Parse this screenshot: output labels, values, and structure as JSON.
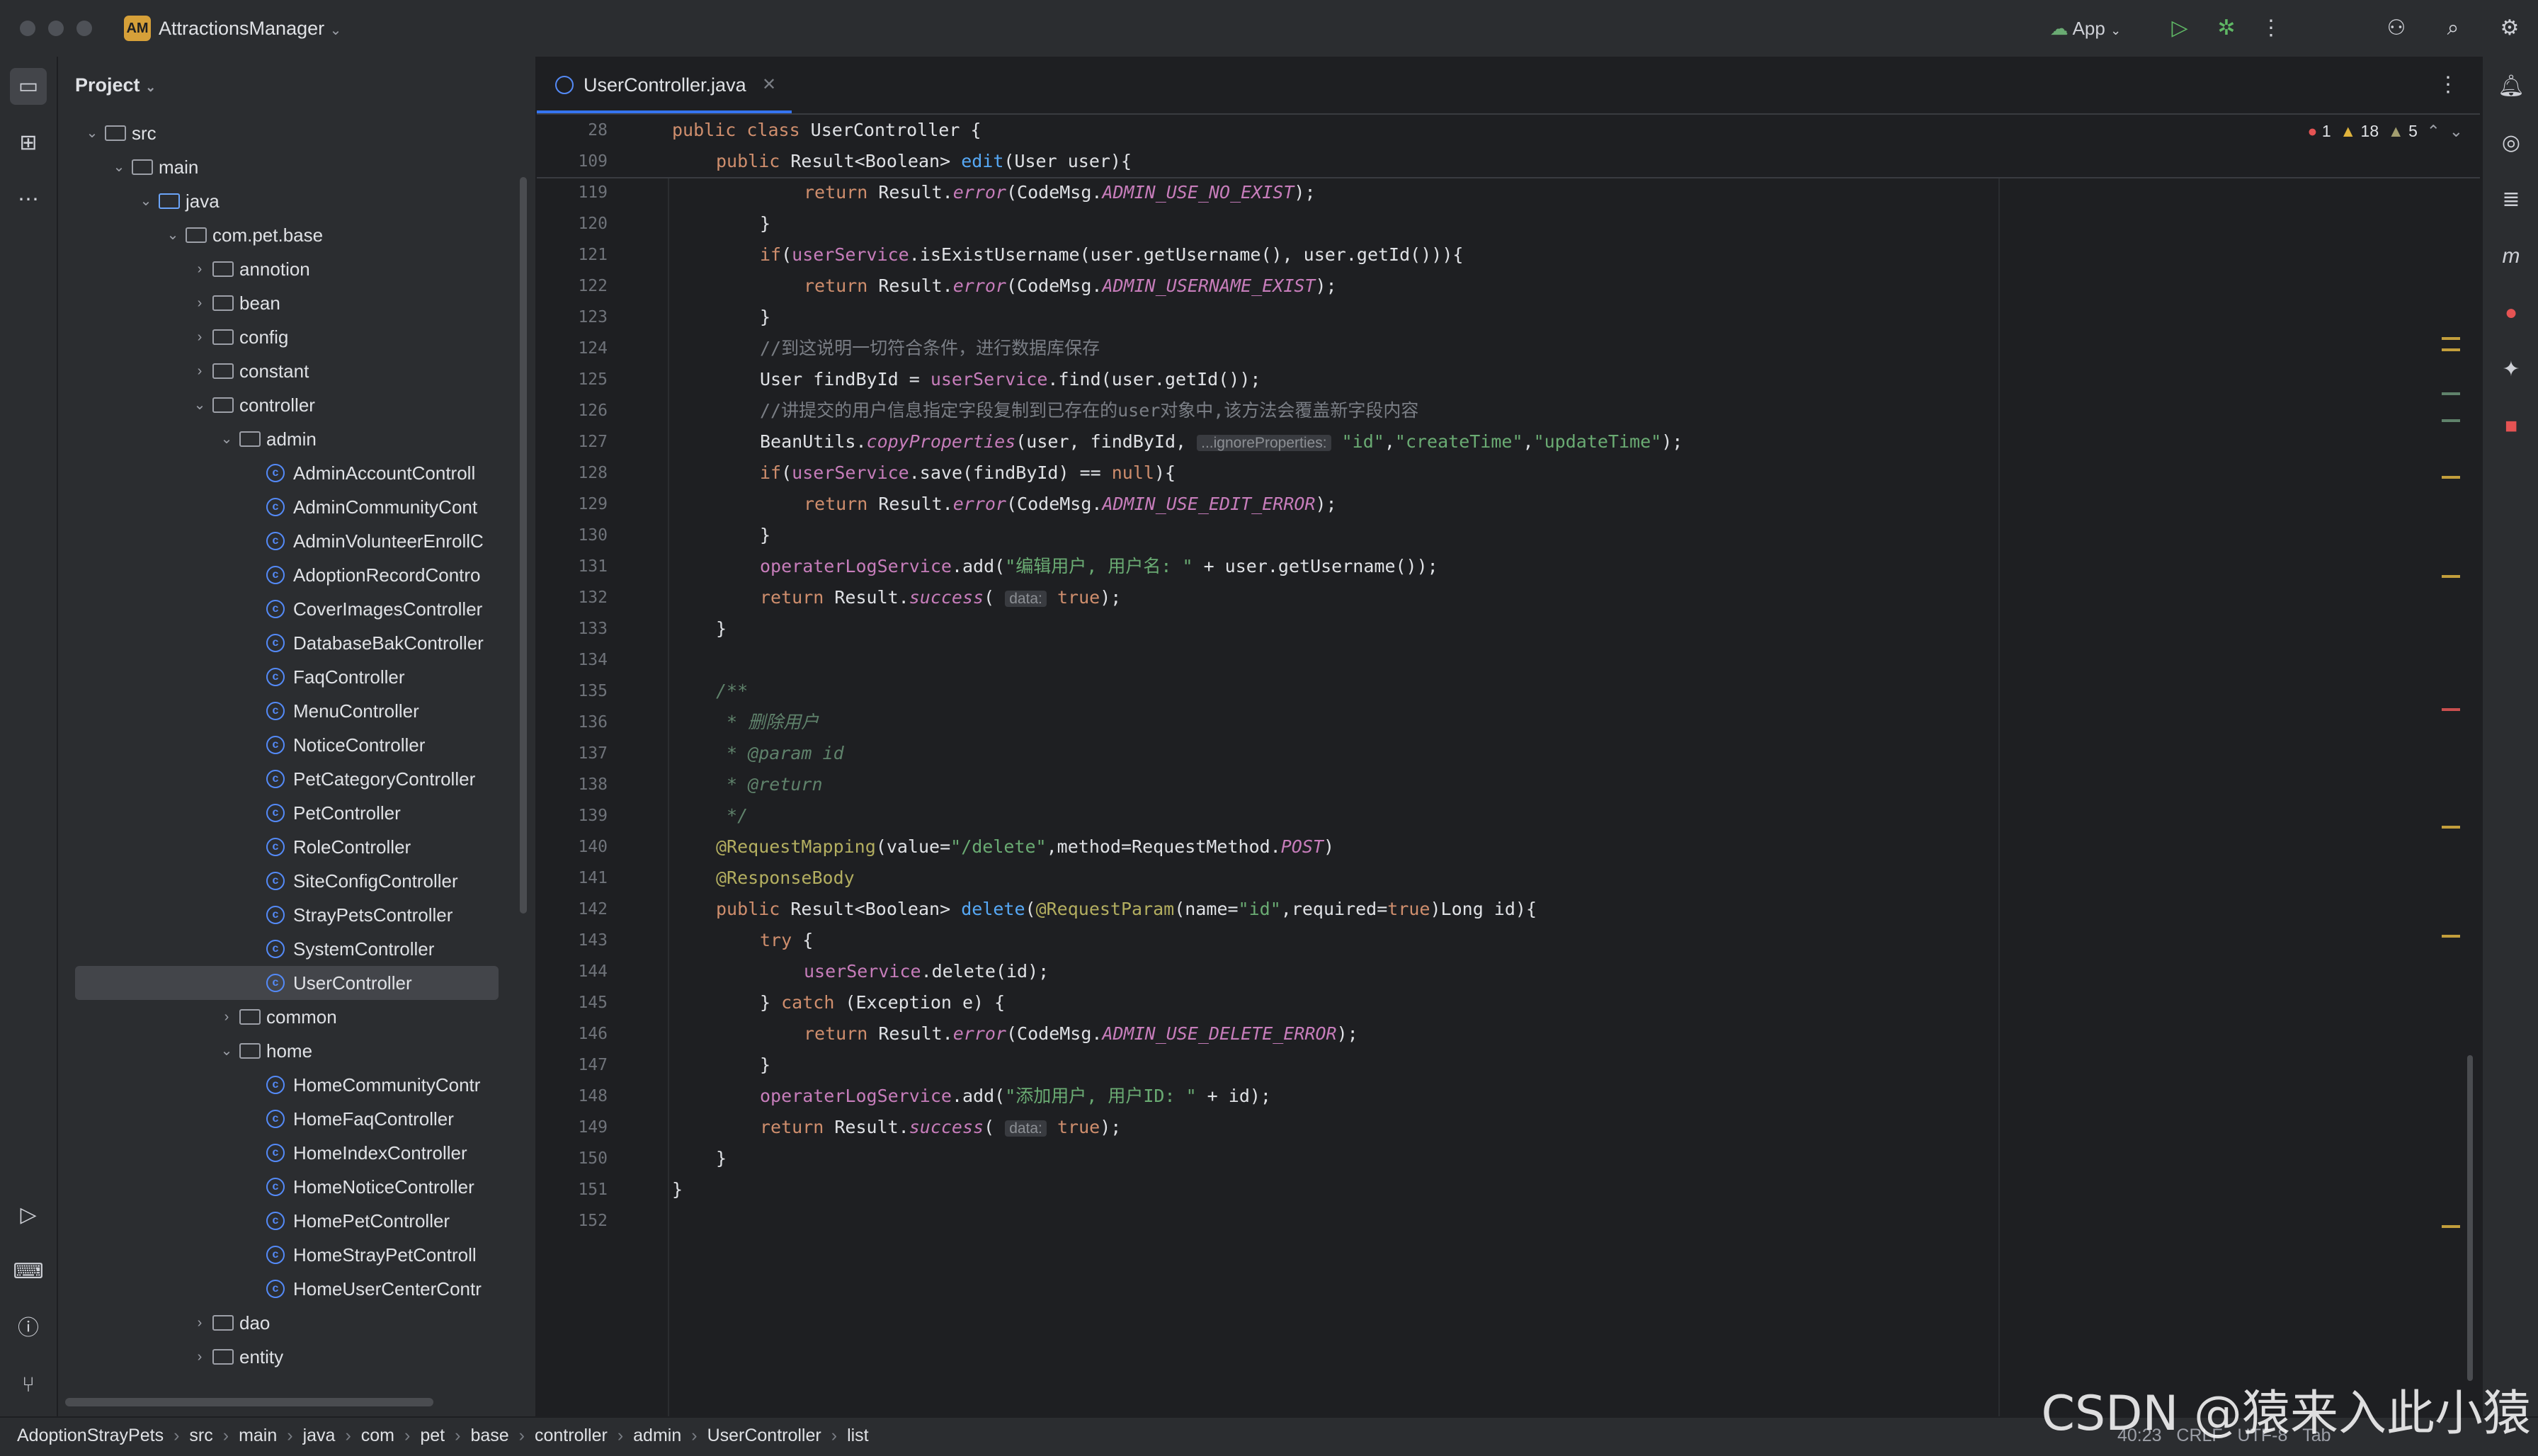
{
  "window": {
    "project_name": "AttractionsManager",
    "project_badge": "AM",
    "run_config": "App"
  },
  "sidebar": {
    "header": "Project",
    "tree": [
      {
        "depth": 1,
        "type": "folder",
        "label": "src",
        "expanded": true
      },
      {
        "depth": 2,
        "type": "folder",
        "label": "main",
        "expanded": true
      },
      {
        "depth": 3,
        "type": "folder-blue",
        "label": "java",
        "expanded": true
      },
      {
        "depth": 4,
        "type": "package",
        "label": "com.pet.base",
        "expanded": true
      },
      {
        "depth": 5,
        "type": "package",
        "label": "annotion",
        "expanded": false
      },
      {
        "depth": 5,
        "type": "package",
        "label": "bean",
        "expanded": false
      },
      {
        "depth": 5,
        "type": "package",
        "label": "config",
        "expanded": false
      },
      {
        "depth": 5,
        "type": "package",
        "label": "constant",
        "expanded": false
      },
      {
        "depth": 5,
        "type": "package",
        "label": "controller",
        "expanded": true
      },
      {
        "depth": 6,
        "type": "package",
        "label": "admin",
        "expanded": true
      },
      {
        "depth": 7,
        "type": "class",
        "label": "AdminAccountControll"
      },
      {
        "depth": 7,
        "type": "class",
        "label": "AdminCommunityCont"
      },
      {
        "depth": 7,
        "type": "class",
        "label": "AdminVolunteerEnrollC"
      },
      {
        "depth": 7,
        "type": "class",
        "label": "AdoptionRecordContro"
      },
      {
        "depth": 7,
        "type": "class",
        "label": "CoverImagesController"
      },
      {
        "depth": 7,
        "type": "class",
        "label": "DatabaseBakController"
      },
      {
        "depth": 7,
        "type": "class",
        "label": "FaqController"
      },
      {
        "depth": 7,
        "type": "class",
        "label": "MenuController"
      },
      {
        "depth": 7,
        "type": "class",
        "label": "NoticeController"
      },
      {
        "depth": 7,
        "type": "class",
        "label": "PetCategoryController"
      },
      {
        "depth": 7,
        "type": "class",
        "label": "PetController"
      },
      {
        "depth": 7,
        "type": "class",
        "label": "RoleController"
      },
      {
        "depth": 7,
        "type": "class",
        "label": "SiteConfigController"
      },
      {
        "depth": 7,
        "type": "class",
        "label": "StrayPetsController"
      },
      {
        "depth": 7,
        "type": "class",
        "label": "SystemController"
      },
      {
        "depth": 7,
        "type": "class",
        "label": "UserController",
        "selected": true
      },
      {
        "depth": 6,
        "type": "package",
        "label": "common",
        "expanded": false
      },
      {
        "depth": 6,
        "type": "package",
        "label": "home",
        "expanded": true
      },
      {
        "depth": 7,
        "type": "class",
        "label": "HomeCommunityContr"
      },
      {
        "depth": 7,
        "type": "class",
        "label": "HomeFaqController"
      },
      {
        "depth": 7,
        "type": "class",
        "label": "HomeIndexController"
      },
      {
        "depth": 7,
        "type": "class",
        "label": "HomeNoticeController"
      },
      {
        "depth": 7,
        "type": "class",
        "label": "HomePetController"
      },
      {
        "depth": 7,
        "type": "class",
        "label": "HomeStrayPetControll"
      },
      {
        "depth": 7,
        "type": "class",
        "label": "HomeUserCenterContr"
      },
      {
        "depth": 5,
        "type": "package",
        "label": "dao",
        "expanded": false
      },
      {
        "depth": 5,
        "type": "package",
        "label": "entity",
        "expanded": false
      }
    ]
  },
  "editor": {
    "tab_label": "UserController.java",
    "inspections": {
      "errors": "1",
      "warnings": "18",
      "weak_warnings": "5"
    },
    "sticky_lines": [
      {
        "num": "28",
        "indent": 0,
        "tokens": [
          {
            "t": "public class ",
            "c": "kw"
          },
          {
            "t": "UserController {",
            "c": ""
          }
        ]
      },
      {
        "num": "109",
        "indent": 1,
        "tokens": [
          {
            "t": "public ",
            "c": "kw"
          },
          {
            "t": "Result<Boolean> ",
            "c": ""
          },
          {
            "t": "edit",
            "c": "fn"
          },
          {
            "t": "(User user){",
            "c": ""
          }
        ]
      }
    ],
    "lines": [
      {
        "num": "119",
        "indent": 3,
        "tokens": [
          {
            "t": "return ",
            "c": "kw"
          },
          {
            "t": "Result.",
            "c": ""
          },
          {
            "t": "error",
            "c": "it"
          },
          {
            "t": "(CodeMsg.",
            "c": ""
          },
          {
            "t": "ADMIN_USE_NO_EXIST",
            "c": "it"
          },
          {
            "t": ");",
            "c": ""
          }
        ]
      },
      {
        "num": "120",
        "indent": 2,
        "tokens": [
          {
            "t": "}",
            "c": ""
          }
        ]
      },
      {
        "num": "121",
        "indent": 2,
        "tokens": [
          {
            "t": "if",
            "c": "kw"
          },
          {
            "t": "(",
            "c": ""
          },
          {
            "t": "userService",
            "c": "fld"
          },
          {
            "t": ".isExistUsername(user.getUsername(), user.getId())){",
            "c": ""
          }
        ]
      },
      {
        "num": "122",
        "indent": 3,
        "tokens": [
          {
            "t": "return ",
            "c": "kw"
          },
          {
            "t": "Result.",
            "c": ""
          },
          {
            "t": "error",
            "c": "it"
          },
          {
            "t": "(CodeMsg.",
            "c": ""
          },
          {
            "t": "ADMIN_USERNAME_EXIST",
            "c": "it"
          },
          {
            "t": ");",
            "c": ""
          }
        ]
      },
      {
        "num": "123",
        "indent": 2,
        "tokens": [
          {
            "t": "}",
            "c": ""
          }
        ]
      },
      {
        "num": "124",
        "indent": 2,
        "tokens": [
          {
            "t": "//到这说明一切符合条件，进行数据库保存",
            "c": "cm"
          }
        ]
      },
      {
        "num": "125",
        "indent": 2,
        "tokens": [
          {
            "t": "User findById = ",
            "c": ""
          },
          {
            "t": "userService",
            "c": "fld"
          },
          {
            "t": ".find(user.getId());",
            "c": ""
          }
        ]
      },
      {
        "num": "126",
        "indent": 2,
        "tokens": [
          {
            "t": "//讲提交的用户信息指定字段复制到已存在的user对象中,该方法会覆盖新字段内容",
            "c": "cm"
          }
        ]
      },
      {
        "num": "127",
        "indent": 2,
        "tokens": [
          {
            "t": "BeanUtils.",
            "c": ""
          },
          {
            "t": "copyProperties",
            "c": "it"
          },
          {
            "t": "(user, findById, ",
            "c": ""
          },
          {
            "t": "...ignoreProperties:",
            "c": "hint"
          },
          {
            "t": " ",
            "c": ""
          },
          {
            "t": "\"id\"",
            "c": "str"
          },
          {
            "t": ",",
            "c": ""
          },
          {
            "t": "\"createTime\"",
            "c": "str"
          },
          {
            "t": ",",
            "c": ""
          },
          {
            "t": "\"updateTime\"",
            "c": "str"
          },
          {
            "t": ");",
            "c": ""
          }
        ]
      },
      {
        "num": "128",
        "indent": 2,
        "tokens": [
          {
            "t": "if",
            "c": "kw"
          },
          {
            "t": "(",
            "c": ""
          },
          {
            "t": "userService",
            "c": "fld"
          },
          {
            "t": ".save(findById) == ",
            "c": ""
          },
          {
            "t": "null",
            "c": "kw"
          },
          {
            "t": "){",
            "c": ""
          }
        ]
      },
      {
        "num": "129",
        "indent": 3,
        "tokens": [
          {
            "t": "return ",
            "c": "kw"
          },
          {
            "t": "Result.",
            "c": ""
          },
          {
            "t": "error",
            "c": "it"
          },
          {
            "t": "(CodeMsg.",
            "c": ""
          },
          {
            "t": "ADMIN_USE_EDIT_ERROR",
            "c": "it"
          },
          {
            "t": ");",
            "c": ""
          }
        ]
      },
      {
        "num": "130",
        "indent": 2,
        "tokens": [
          {
            "t": "}",
            "c": ""
          }
        ]
      },
      {
        "num": "131",
        "indent": 2,
        "tokens": [
          {
            "t": "operaterLogService",
            "c": "fld"
          },
          {
            "t": ".add(",
            "c": ""
          },
          {
            "t": "\"编辑用户, 用户名: \"",
            "c": "str"
          },
          {
            "t": " + user.getUsername());",
            "c": ""
          }
        ]
      },
      {
        "num": "132",
        "indent": 2,
        "tokens": [
          {
            "t": "return ",
            "c": "kw"
          },
          {
            "t": "Result.",
            "c": ""
          },
          {
            "t": "success",
            "c": "it"
          },
          {
            "t": "( ",
            "c": ""
          },
          {
            "t": "data:",
            "c": "hint"
          },
          {
            "t": " ",
            "c": ""
          },
          {
            "t": "true",
            "c": "kw"
          },
          {
            "t": ");",
            "c": ""
          }
        ]
      },
      {
        "num": "133",
        "indent": 1,
        "tokens": [
          {
            "t": "}",
            "c": ""
          }
        ]
      },
      {
        "num": "134",
        "indent": 0,
        "tokens": []
      },
      {
        "num": "135",
        "indent": 1,
        "tokens": [
          {
            "t": "/**",
            "c": "cmi"
          }
        ]
      },
      {
        "num": "136",
        "indent": 1,
        "tokens": [
          {
            "t": " * 删除用户",
            "c": "cmi"
          }
        ]
      },
      {
        "num": "137",
        "indent": 1,
        "tokens": [
          {
            "t": " * ",
            "c": "cmi"
          },
          {
            "t": "@param",
            "c": "cmi"
          },
          {
            "t": " id",
            "c": "cmi"
          }
        ]
      },
      {
        "num": "138",
        "indent": 1,
        "tokens": [
          {
            "t": " * ",
            "c": "cmi"
          },
          {
            "t": "@return",
            "c": "cmi"
          }
        ]
      },
      {
        "num": "139",
        "indent": 1,
        "tokens": [
          {
            "t": " */",
            "c": "cmi"
          }
        ]
      },
      {
        "num": "140",
        "indent": 1,
        "tokens": [
          {
            "t": "@RequestMapping",
            "c": "ann"
          },
          {
            "t": "(value=",
            "c": ""
          },
          {
            "t": "\"/delete\"",
            "c": "str"
          },
          {
            "t": ",method=RequestMethod.",
            "c": ""
          },
          {
            "t": "POST",
            "c": "it"
          },
          {
            "t": ")",
            "c": ""
          }
        ]
      },
      {
        "num": "141",
        "indent": 1,
        "tokens": [
          {
            "t": "@ResponseBody",
            "c": "ann"
          }
        ]
      },
      {
        "num": "142",
        "indent": 1,
        "tokens": [
          {
            "t": "public ",
            "c": "kw"
          },
          {
            "t": "Result<Boolean> ",
            "c": ""
          },
          {
            "t": "delete",
            "c": "fn"
          },
          {
            "t": "(",
            "c": ""
          },
          {
            "t": "@RequestParam",
            "c": "ann"
          },
          {
            "t": "(name=",
            "c": ""
          },
          {
            "t": "\"id\"",
            "c": "str"
          },
          {
            "t": ",required=",
            "c": ""
          },
          {
            "t": "true",
            "c": "kw"
          },
          {
            "t": ")Long id){",
            "c": ""
          }
        ]
      },
      {
        "num": "143",
        "indent": 2,
        "tokens": [
          {
            "t": "try ",
            "c": "kw"
          },
          {
            "t": "{",
            "c": ""
          }
        ]
      },
      {
        "num": "144",
        "indent": 3,
        "tokens": [
          {
            "t": "userService",
            "c": "fld"
          },
          {
            "t": ".delete(id);",
            "c": ""
          }
        ]
      },
      {
        "num": "145",
        "indent": 2,
        "tokens": [
          {
            "t": "} ",
            "c": ""
          },
          {
            "t": "catch ",
            "c": "kw"
          },
          {
            "t": "(Exception e) {",
            "c": ""
          }
        ]
      },
      {
        "num": "146",
        "indent": 3,
        "tokens": [
          {
            "t": "return ",
            "c": "kw"
          },
          {
            "t": "Result.",
            "c": ""
          },
          {
            "t": "error",
            "c": "it"
          },
          {
            "t": "(CodeMsg.",
            "c": ""
          },
          {
            "t": "ADMIN_USE_DELETE_ERROR",
            "c": "it"
          },
          {
            "t": ");",
            "c": ""
          }
        ]
      },
      {
        "num": "147",
        "indent": 2,
        "tokens": [
          {
            "t": "}",
            "c": ""
          }
        ]
      },
      {
        "num": "148",
        "indent": 2,
        "tokens": [
          {
            "t": "operaterLogService",
            "c": "fld"
          },
          {
            "t": ".add(",
            "c": ""
          },
          {
            "t": "\"添加用户, 用户ID: \"",
            "c": "str"
          },
          {
            "t": " + id);",
            "c": ""
          }
        ]
      },
      {
        "num": "149",
        "indent": 2,
        "tokens": [
          {
            "t": "return ",
            "c": "kw"
          },
          {
            "t": "Result.",
            "c": ""
          },
          {
            "t": "success",
            "c": "it"
          },
          {
            "t": "( ",
            "c": ""
          },
          {
            "t": "data:",
            "c": "hint"
          },
          {
            "t": " ",
            "c": ""
          },
          {
            "t": "true",
            "c": "kw"
          },
          {
            "t": ");",
            "c": ""
          }
        ]
      },
      {
        "num": "150",
        "indent": 1,
        "tokens": [
          {
            "t": "}",
            "c": ""
          }
        ]
      },
      {
        "num": "151",
        "indent": 0,
        "tokens": [
          {
            "t": "}",
            "c": ""
          }
        ]
      },
      {
        "num": "152",
        "indent": 0,
        "tokens": []
      }
    ]
  },
  "statusbar": {
    "breadcrumbs": [
      "AdoptionStrayPets",
      "src",
      "main",
      "java",
      "com",
      "pet",
      "base",
      "controller",
      "admin",
      "UserController",
      "list"
    ],
    "position": "40:23",
    "line_separator": "CRLF",
    "encoding": "UTF-8",
    "indent": "Tab"
  },
  "watermark": "CSDN @猿来入此小猿"
}
